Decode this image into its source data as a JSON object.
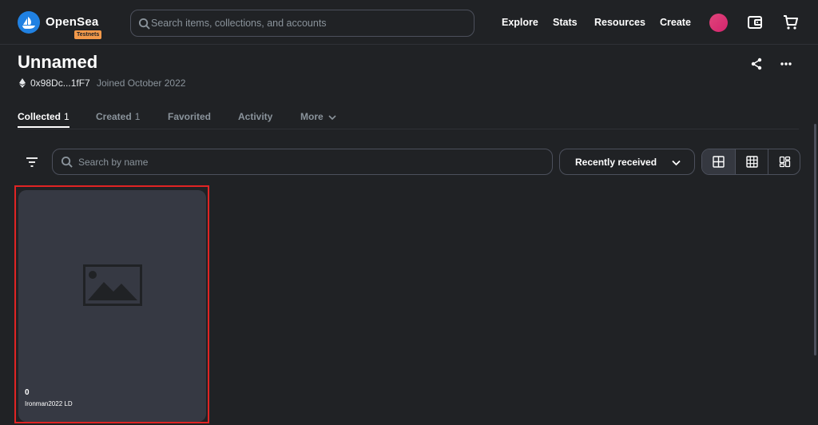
{
  "header": {
    "brand": "OpenSea",
    "badge": "Testnets",
    "search_placeholder": "Search items, collections, and accounts",
    "nav": [
      "Explore",
      "Stats",
      "Resources",
      "Create"
    ]
  },
  "profile": {
    "name": "Unnamed",
    "address": "0x98Dc...1fF7",
    "joined": "Joined October 2022"
  },
  "tabs": [
    {
      "label": "Collected",
      "count": "1"
    },
    {
      "label": "Created",
      "count": "1"
    },
    {
      "label": "Favorited",
      "count": ""
    },
    {
      "label": "Activity",
      "count": ""
    },
    {
      "label": "More",
      "count": ""
    }
  ],
  "toolbar": {
    "search_placeholder": "Search by name",
    "sort_label": "Recently received"
  },
  "items": [
    {
      "price": "0",
      "name": "Ironman2022 LD"
    }
  ],
  "colors": {
    "background": "#202225",
    "card": "#363943",
    "border": "#4c505c",
    "accent": "#2081e2",
    "highlight": "#e02424"
  }
}
